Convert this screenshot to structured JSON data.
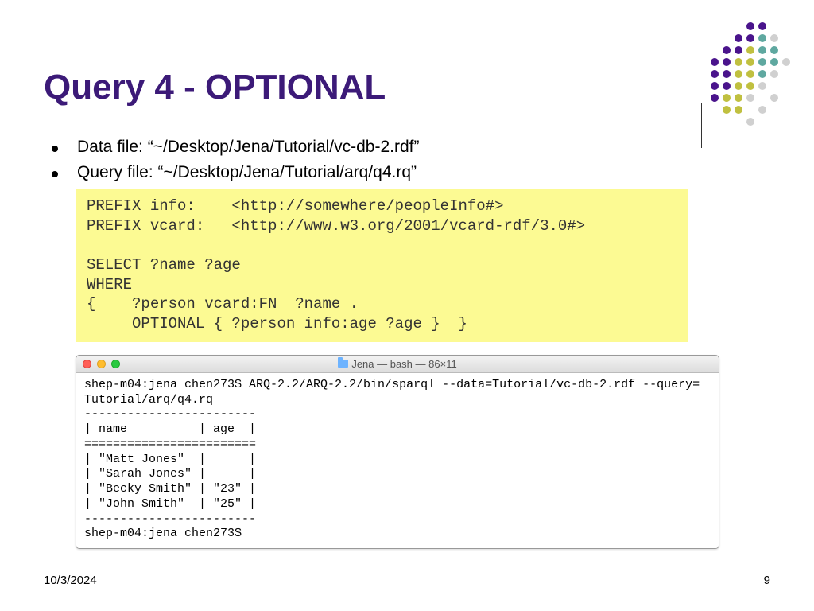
{
  "title": "Query 4 - OPTIONAL",
  "bullets": [
    "Data file: “~/Desktop/Jena/Tutorial/vc-db-2.rdf”",
    "Query file: “~/Desktop/Jena/Tutorial/arq/q4.rq”"
  ],
  "code": "PREFIX info:    <http://somewhere/peopleInfo#>\nPREFIX vcard:   <http://www.w3.org/2001/vcard-rdf/3.0#>\n\nSELECT ?name ?age\nWHERE\n{    ?person vcard:FN  ?name .\n     OPTIONAL { ?person info:age ?age }  }",
  "terminal": {
    "title": "Jena — bash — 86×11",
    "body": "shep-m04:jena chen273$ ARQ-2.2/ARQ-2.2/bin/sparql --data=Tutorial/vc-db-2.rdf --query=\nTutorial/arq/q4.rq\n------------------------\n| name          | age  |\n========================\n| \"Matt Jones\"  |      |\n| \"Sarah Jones\" |      |\n| \"Becky Smith\" | \"23\" |\n| \"John Smith\"  | \"25\" |\n------------------------\nshep-m04:jena chen273$ "
  },
  "footer": {
    "date": "10/3/2024",
    "page": "9"
  },
  "colors": {
    "purple": "#4a148c",
    "olive": "#a0a040",
    "teal": "#5fa8a0",
    "ltblue": "#d0d0d0"
  }
}
